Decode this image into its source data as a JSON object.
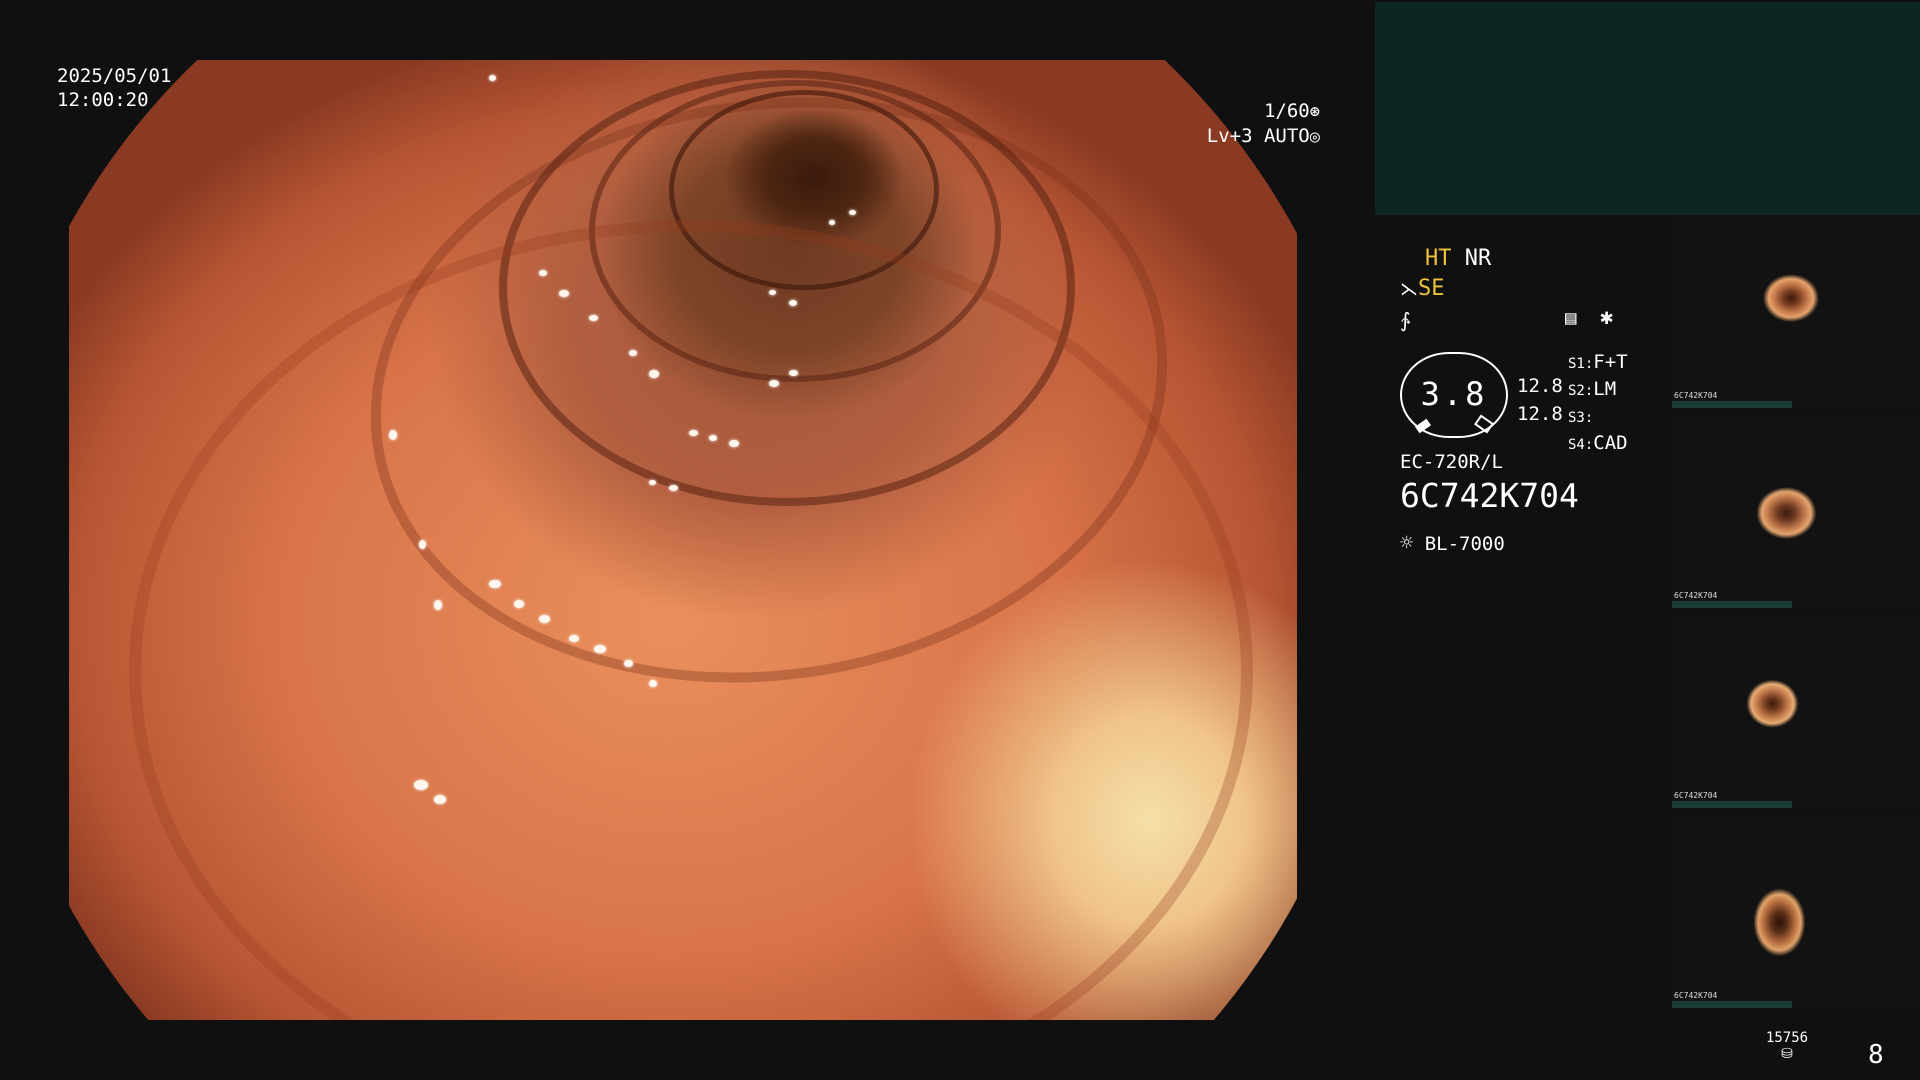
{
  "datetime": {
    "date": "2025/05/01",
    "time": "12:00:20"
  },
  "exposure": {
    "shutter": "1/60",
    "level": "Lv+3",
    "mode": "AUTO"
  },
  "enhancement": {
    "ht": "HT",
    "nr": "NR",
    "se": "SE"
  },
  "magnification": {
    "value": "3.8",
    "upper": "12.8",
    "lower": "12.8"
  },
  "switches": [
    {
      "key": "S1:",
      "value": "F+T"
    },
    {
      "key": "S2:",
      "value": "LM"
    },
    {
      "key": "S3:",
      "value": ""
    },
    {
      "key": "S4:",
      "value": "CAD"
    }
  ],
  "scope": {
    "model": "EC-720R/L",
    "serial": "6C742K704"
  },
  "light_source": {
    "model": "BL-7000"
  },
  "storage": {
    "count": "15756",
    "page": "8"
  },
  "thumbnails": [
    {
      "label": "6C742K704"
    },
    {
      "label": "6C742K704"
    },
    {
      "label": "6C742K704"
    },
    {
      "label": "6C742K704"
    }
  ],
  "colors": {
    "accent_yellow": "#f0c23c",
    "panel_dark": "#0e2622"
  },
  "icons": [
    "shutter-icon",
    "iris-icon",
    "scope-switch-icon",
    "filter-icon",
    "memo-icon",
    "asterisk-icon",
    "lamp-icon",
    "storage-icon"
  ]
}
